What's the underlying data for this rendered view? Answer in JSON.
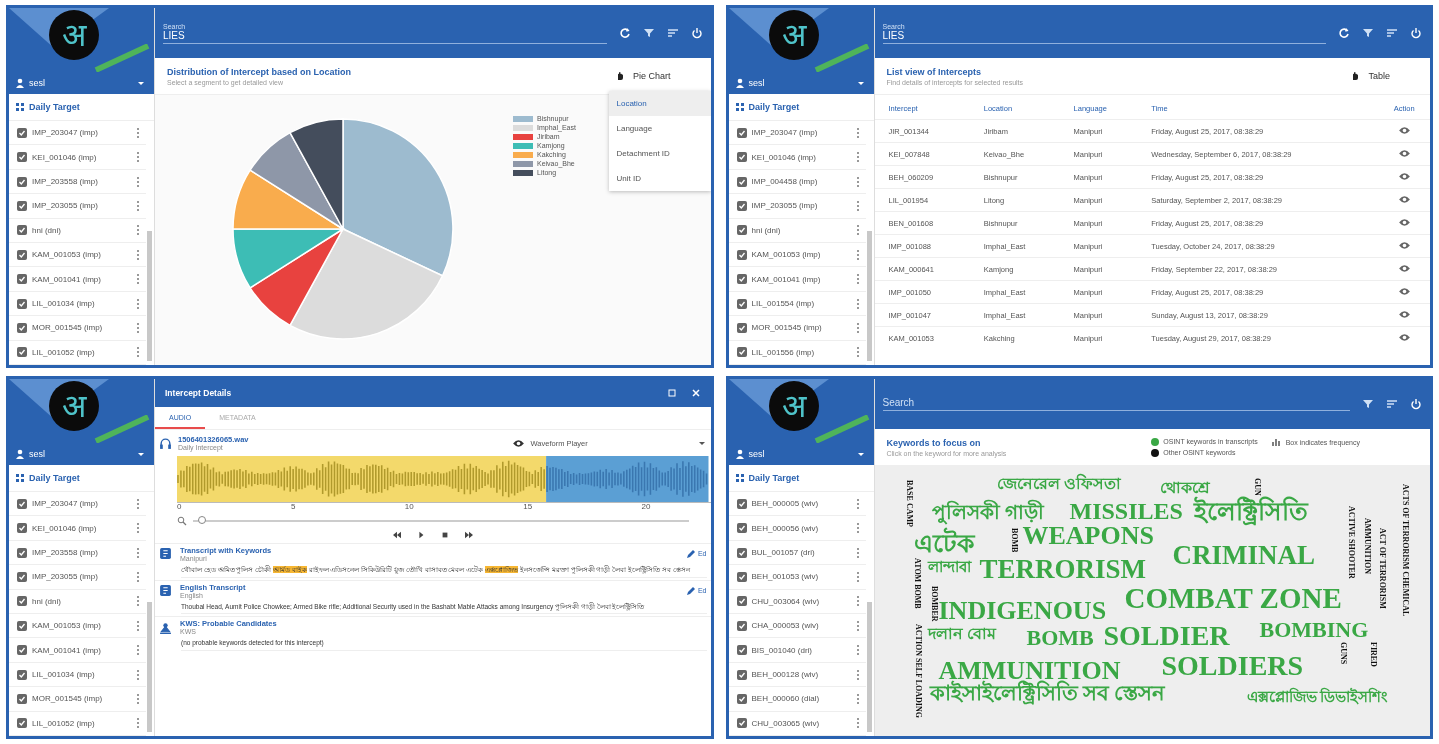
{
  "screens": [
    {
      "kind": "chart",
      "logo": "अ",
      "user": "sesl",
      "target_title": "Daily Target",
      "targets": [
        {
          "label": "IMP_203047 (imp)",
          "checked": true
        },
        {
          "label": "KEI_001046 (imp)",
          "checked": true
        },
        {
          "label": "IMP_203558 (imp)",
          "checked": true
        },
        {
          "label": "IMP_203055 (imp)",
          "checked": true
        },
        {
          "label": "hni (dni)",
          "checked": true
        },
        {
          "label": "KAM_001053 (imp)",
          "checked": true
        },
        {
          "label": "KAM_001041 (imp)",
          "checked": true
        },
        {
          "label": "LIL_001034 (imp)",
          "checked": true
        },
        {
          "label": "MOR_001545 (imp)",
          "checked": true
        },
        {
          "label": "LIL_001052 (imp)",
          "checked": true
        }
      ],
      "search": {
        "label": "Search",
        "value": "LIES"
      },
      "card": {
        "title": "Distribution of Intercept based on Location",
        "subtitle": "Select a segment to get detailed view",
        "view_button": "Pie Chart"
      },
      "menu": [
        {
          "label": "Location",
          "selected": true
        },
        {
          "label": "Language",
          "selected": false
        },
        {
          "label": "Detachment ID",
          "selected": false
        },
        {
          "label": "Unit ID",
          "selected": false
        }
      ],
      "legend": [
        {
          "label": "Bishnupur",
          "color": "#9dbbcf"
        },
        {
          "label": "Imphal_East",
          "color": "#dcdcdc"
        },
        {
          "label": "Jiribam",
          "color": "#e8423f"
        },
        {
          "label": "Kamjong",
          "color": "#3dbdb5"
        },
        {
          "label": "Kakching",
          "color": "#f9ac4d"
        },
        {
          "label": "Keivao_Bhe",
          "color": "#8e97a8"
        },
        {
          "label": "Litong",
          "color": "#444d5c"
        }
      ]
    },
    {
      "kind": "table",
      "logo": "अ",
      "user": "sesl",
      "target_title": "Daily Target",
      "targets": [
        {
          "label": "IMP_203047 (imp)",
          "checked": true
        },
        {
          "label": "KEI_001046 (imp)",
          "checked": true
        },
        {
          "label": "IMP_004458 (imp)",
          "checked": true
        },
        {
          "label": "IMP_203055 (imp)",
          "checked": true
        },
        {
          "label": "hni (dni)",
          "checked": true
        },
        {
          "label": "KAM_001053 (imp)",
          "checked": true
        },
        {
          "label": "KAM_001041 (imp)",
          "checked": true
        },
        {
          "label": "LIL_001554 (imp)",
          "checked": true
        },
        {
          "label": "MOR_001545 (imp)",
          "checked": true
        },
        {
          "label": "LIL_001556 (imp)",
          "checked": true
        }
      ],
      "search": {
        "label": "Search",
        "value": "LIES"
      },
      "card": {
        "title": "List view of Intercepts",
        "subtitle": "Find details of intercepts for selected results",
        "view_button": "Table"
      },
      "table": {
        "columns": [
          "Intercept",
          "Location",
          "Language",
          "Time",
          "Action"
        ],
        "rows": [
          [
            "JIR_001344",
            "Jiribam",
            "Manipuri",
            "Friday, August 25, 2017, 08:38:29"
          ],
          [
            "KEI_007848",
            "Keivao_Bhe",
            "Manipuri",
            "Wednesday, September 6, 2017, 08:38:29"
          ],
          [
            "BEH_060209",
            "Bishnupur",
            "Manipuri",
            "Friday, August 25, 2017, 08:38:29"
          ],
          [
            "LIL_001954",
            "Litong",
            "Manipuri",
            "Saturday, September 2, 2017, 08:38:29"
          ],
          [
            "BEN_001608",
            "Bishnupur",
            "Manipuri",
            "Friday, August 25, 2017, 08:38:29"
          ],
          [
            "IMP_001088",
            "Imphal_East",
            "Manipuri",
            "Tuesday, October 24, 2017, 08:38:29"
          ],
          [
            "KAM_000641",
            "Kamjong",
            "Manipuri",
            "Friday, September 22, 2017, 08:38:29"
          ],
          [
            "IMP_001050",
            "Imphal_East",
            "Manipuri",
            "Friday, August 25, 2017, 08:38:29"
          ],
          [
            "IMP_001047",
            "Imphal_East",
            "Manipuri",
            "Sunday, August 13, 2017, 08:38:29"
          ],
          [
            "KAM_001053",
            "Kakching",
            "Manipuri",
            "Tuesday, August 29, 2017, 08:38:29"
          ]
        ]
      }
    },
    {
      "kind": "details",
      "logo": "अ",
      "user": "sesl",
      "target_title": "Daily Target",
      "targets": [
        {
          "label": "IMP_203047 (imp)",
          "checked": true
        },
        {
          "label": "KEI_001046 (imp)",
          "checked": true
        },
        {
          "label": "IMP_203558 (imp)",
          "checked": true
        },
        {
          "label": "IMP_203055 (imp)",
          "checked": true
        },
        {
          "label": "hni (dni)",
          "checked": true
        },
        {
          "label": "KAM_001053 (imp)",
          "checked": true
        },
        {
          "label": "KAM_001041 (imp)",
          "checked": true
        },
        {
          "label": "LIL_001034 (imp)",
          "checked": true
        },
        {
          "label": "MOR_001545 (imp)",
          "checked": true
        },
        {
          "label": "LIL_001052 (imp)",
          "checked": true
        }
      ],
      "dialog_title": "Intercept Details",
      "tabs": [
        {
          "label": "AUDIO",
          "selected": true
        },
        {
          "label": "METADATA",
          "selected": false
        }
      ],
      "file": {
        "name": "1506401326065.wav",
        "subtitle": "Daily Intercept"
      },
      "player": "Waveform Player",
      "timeline": [
        "0",
        "5",
        "10",
        "15",
        "20"
      ],
      "zoom": {
        "level": 0.01
      },
      "sections": [
        {
          "kind": "transcript",
          "title": "Transcript with Keywords",
          "subtitle": "Manipuri",
          "edit": "Ed",
          "segments": [
            {
              "text": "থৌবাল হেড অমিত পুলিস চৌকী ",
              "highlight": false
            },
            {
              "text": "আর্মড বাইক",
              "highlight": true
            },
            {
              "text": " রাইফল এডিসনেল সিকিউরিটি য়ুজ তৌখি বাসাবত মেবল এটেক ",
              "highlight": false
            },
            {
              "text": "এক্সপ্লোজিভ",
              "highlight": true
            },
            {
              "text": " ইনসর্জেন্সি মরক্তা পুলিসকী গাড়ী লৈবা ইলেক্ট্রিসিতি সব স্তেসন",
              "highlight": false
            }
          ]
        },
        {
          "kind": "transcript",
          "title": "English Transcript",
          "subtitle": "English",
          "edit": "Ed",
          "segments": [
            {
              "text": "Thoubal Head, Aumit Police Chowkee; Armed Bike rifle; Additional Security used in the Bashabt Mable Attacks among Insurgency পুলিসকী গাড়ী লৈবা ইলেক্ট্রিসিতি",
              "highlight": false
            }
          ]
        },
        {
          "kind": "kws",
          "title": "KWS: Probable Candidates",
          "subtitle": "KWS",
          "segments": [
            {
              "text": "(no probable keywords detected for this intercept)",
              "highlight": false
            }
          ]
        }
      ]
    },
    {
      "kind": "cloud",
      "logo": "अ",
      "user": "sesl",
      "target_title": "Daily Target",
      "targets": [
        {
          "label": "BEH_000005 (wiv)",
          "checked": true
        },
        {
          "label": "BEH_000056 (wiv)",
          "checked": true
        },
        {
          "label": "BUL_001057 (dri)",
          "checked": true
        },
        {
          "label": "BEH_001053 (wiv)",
          "checked": true
        },
        {
          "label": "CHU_003064 (wiv)",
          "checked": true
        },
        {
          "label": "CHA_000053 (wiv)",
          "checked": true
        },
        {
          "label": "BIS_001040 (dri)",
          "checked": true
        },
        {
          "label": "BEH_000128 (wiv)",
          "checked": true
        },
        {
          "label": "BEH_000060 (dial)",
          "checked": true
        },
        {
          "label": "CHU_003065 (wiv)",
          "checked": true
        }
      ],
      "search": {
        "placeholder": "Search"
      },
      "card": {
        "title": "Keywords to focus on",
        "subtitle": "Click on the keyword for more analysis"
      },
      "legend": [
        {
          "label": "OSINT keywords in transcripts",
          "color": "#3aa845"
        },
        {
          "label": "Other OSINT keywords",
          "color": "#111111"
        }
      ],
      "frequency_toggle": "Box indicates frequency",
      "words": [
        {
          "text": "জেনেরেল ওফিসতা",
          "color": "#3aa845",
          "kind": "horizontal"
        },
        {
          "text": "থোকশ্রে",
          "color": "#3aa845",
          "kind": "horizontal"
        },
        {
          "text": "পুলিসকী গাড়ী",
          "color": "#3aa845",
          "kind": "horizontal"
        },
        {
          "text": "MISSILES",
          "color": "#3aa845",
          "kind": "horizontal"
        },
        {
          "text": "ইলেক্ট্রিসিতি",
          "color": "#3aa845",
          "kind": "horizontal"
        },
        {
          "text": "এটেক",
          "color": "#3aa845",
          "kind": "horizontal"
        },
        {
          "text": "WEAPONS",
          "color": "#3aa845",
          "kind": "horizontal"
        },
        {
          "text": "CRIMINAL",
          "color": "#3aa845",
          "kind": "horizontal"
        },
        {
          "text": "লান্দাবা",
          "color": "#3aa845",
          "kind": "horizontal"
        },
        {
          "text": "TERRORISM",
          "color": "#3aa845",
          "kind": "horizontal"
        },
        {
          "text": "COMBAT ZONE",
          "color": "#3aa845",
          "kind": "horizontal"
        },
        {
          "text": "INDIGENOUS",
          "color": "#3aa845",
          "kind": "horizontal"
        },
        {
          "text": "দলান বোম",
          "color": "#3aa845",
          "kind": "horizontal"
        },
        {
          "text": "BOMB",
          "color": "#3aa845",
          "kind": "horizontal"
        },
        {
          "text": "SOLDIER",
          "color": "#3aa845",
          "kind": "horizontal"
        },
        {
          "text": "BOMBING",
          "color": "#3aa845",
          "kind": "horizontal"
        },
        {
          "text": "AMMUNITION",
          "color": "#3aa845",
          "kind": "horizontal"
        },
        {
          "text": "SOLDIERS",
          "color": "#3aa845",
          "kind": "horizontal"
        },
        {
          "text": "কাইসাইলেক্ট্রিসিতি সব স্তেসন",
          "color": "#3aa845",
          "kind": "horizontal"
        },
        {
          "text": "এক্সপ্লোজিভ ডিভাইসশিং",
          "color": "#3aa845",
          "kind": "horizontal"
        },
        {
          "text": "BASE CAMP",
          "color": "#111111",
          "kind": "vertical"
        },
        {
          "text": "BOMB",
          "color": "#111111",
          "kind": "vertical"
        },
        {
          "text": "ATOM BOMB",
          "color": "#111111",
          "kind": "vertical"
        },
        {
          "text": "BOMBER",
          "color": "#111111",
          "kind": "vertical"
        },
        {
          "text": "ACTION SELF LOADING",
          "color": "#111111",
          "kind": "vertical"
        },
        {
          "text": "GUN",
          "color": "#111111",
          "kind": "vertical"
        },
        {
          "text": "ACTIVE SHOOTER",
          "color": "#111111",
          "kind": "vertical"
        },
        {
          "text": "AMMUNITION",
          "color": "#111111",
          "kind": "vertical"
        },
        {
          "text": "ACT OF TERRORISM",
          "color": "#111111",
          "kind": "vertical"
        },
        {
          "text": "ACTS OF TERRORISM CHEMICAL",
          "color": "#111111",
          "kind": "vertical"
        },
        {
          "text": "GUNS",
          "color": "#111111",
          "kind": "vertical"
        },
        {
          "text": "FIRED",
          "color": "#111111",
          "kind": "vertical"
        }
      ]
    }
  ]
}
